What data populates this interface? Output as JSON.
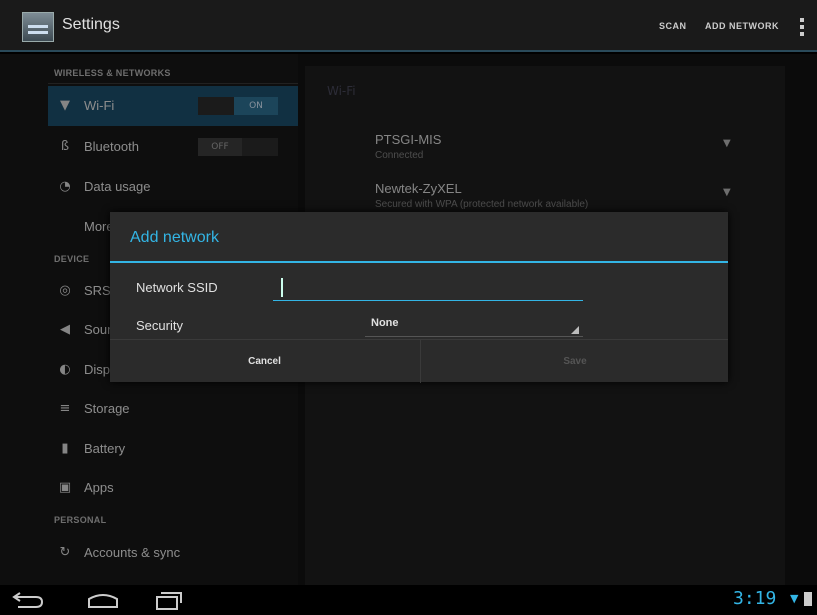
{
  "actionbar": {
    "title": "Settings",
    "scan_label": "SCAN",
    "add_network_label": "ADD NETWORK"
  },
  "sidebar": {
    "sections": [
      "WIRELESS & NETWORKS",
      "DEVICE",
      "PERSONAL"
    ],
    "items": [
      {
        "label": "Wi-Fi",
        "icon": "wifi-icon",
        "toggle": "ON",
        "selected": true
      },
      {
        "label": "Bluetooth",
        "icon": "bluetooth-icon",
        "toggle": "OFF"
      },
      {
        "label": "Data usage",
        "icon": "data-usage-icon"
      },
      {
        "label": "More...",
        "icon": ""
      },
      {
        "label": "SRS",
        "icon": "srs-icon"
      },
      {
        "label": "Sound",
        "icon": "sound-icon"
      },
      {
        "label": "Display",
        "icon": "display-icon"
      },
      {
        "label": "Storage",
        "icon": "storage-icon"
      },
      {
        "label": "Battery",
        "icon": "battery-icon"
      },
      {
        "label": "Apps",
        "icon": "apps-icon"
      },
      {
        "label": "Accounts & sync",
        "icon": "sync-icon"
      }
    ]
  },
  "wifi_pane": {
    "heading": "Wi-Fi",
    "networks": [
      {
        "name": "PTSGI-MIS",
        "status": "Connected"
      },
      {
        "name": "Newtek-ZyXEL",
        "status": "Secured with WPA (protected network available)"
      }
    ]
  },
  "dialog": {
    "title": "Add network",
    "ssid_label": "Network SSID",
    "ssid_value": "",
    "security_label": "Security",
    "security_value": "None",
    "cancel_label": "Cancel",
    "save_label": "Save"
  },
  "statusbar": {
    "time": "3:19"
  },
  "colors": {
    "accent": "#33b5e5",
    "selected_item": "#1b4a66"
  }
}
